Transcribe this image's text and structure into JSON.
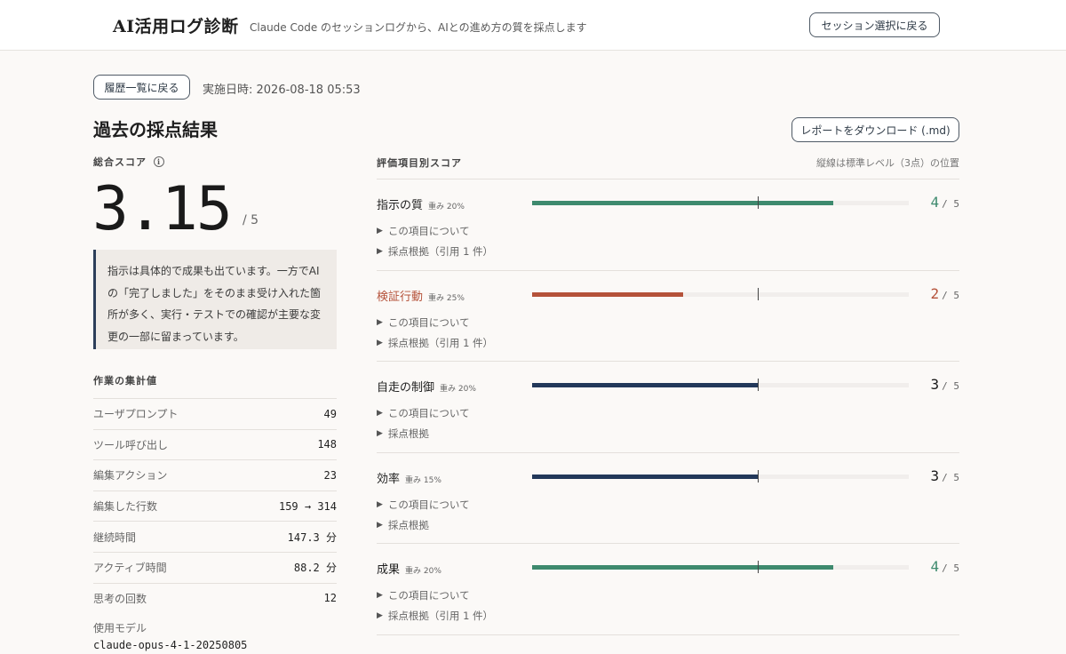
{
  "header": {
    "app_title": "AI活用ログ診断",
    "subtitle": "Claude Code のセッションログから、AIとの進め方の質を採点します",
    "back_to_session_label": "セッション選択に戻る"
  },
  "toolbar": {
    "back_to_history_label": "履歴一覧に戻る",
    "executed_at": "実施日時: 2026-08-18 05:53",
    "download_label": "レポートをダウンロード (.md)"
  },
  "page_title": "過去の採点結果",
  "overall": {
    "label": "総合スコア",
    "info_glyph": "i",
    "score": "3.15",
    "denominator": "/ 5",
    "summary": "指示は具体的で成果も出ています。一方でAIの「完了しました」をそのまま受け入れた箇所が多く、実行・テストでの確認が主要な変更の一部に留まっています。"
  },
  "stats": {
    "heading": "作業の集計値",
    "rows": [
      {
        "label": "ユーザプロンプト",
        "value": "49"
      },
      {
        "label": "ツール呼び出し",
        "value": "148"
      },
      {
        "label": "編集アクション",
        "value": "23"
      },
      {
        "label": "編集した行数",
        "value": "159 → 314"
      },
      {
        "label": "継続時間",
        "value": "147.3 分"
      },
      {
        "label": "アクティブ時間",
        "value": "88.2 分"
      },
      {
        "label": "思考の回数",
        "value": "12"
      }
    ],
    "model_label": "使用モデル",
    "model_value": "claude-opus-4-1-20250805"
  },
  "criteria": {
    "heading": "評価項目別スコア",
    "note": "縦線は標準レベル（3点）の位置",
    "max_score": 5,
    "standard_score": 3,
    "denominator": "/ 5",
    "items": [
      {
        "name": "指示の質",
        "weight": "重み 20%",
        "score": 4,
        "score_text": "4",
        "color": "#3e8a6e",
        "about": "この項目について",
        "evidence": "採点根拠（引用 1 件）"
      },
      {
        "name": "検証行動",
        "weight": "重み 25%",
        "score": 2,
        "score_text": "2",
        "color": "#b5523a",
        "about": "この項目について",
        "evidence": "採点根拠（引用 1 件）"
      },
      {
        "name": "自走の制御",
        "weight": "重み 20%",
        "score": 3,
        "score_text": "3",
        "color": "#22385a",
        "about": "この項目について",
        "evidence": "採点根拠"
      },
      {
        "name": "効率",
        "weight": "重み 15%",
        "score": 3,
        "score_text": "3",
        "color": "#22385a",
        "about": "この項目について",
        "evidence": "採点根拠"
      },
      {
        "name": "成果",
        "weight": "重み 20%",
        "score": 4,
        "score_text": "4",
        "color": "#3e8a6e",
        "about": "この項目について",
        "evidence": "採点根拠（引用 1 件）"
      }
    ]
  },
  "colors": {
    "good": "#3e8a6e",
    "warn": "#b5523a",
    "neutral": "#22385a",
    "accent_border": "#2c3e5a"
  },
  "icons": {
    "info": "info-icon",
    "expander": "triangle-right-icon"
  }
}
